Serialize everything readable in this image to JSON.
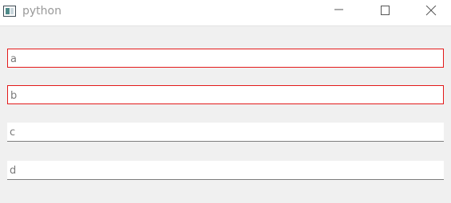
{
  "window": {
    "title": "python",
    "icon": "python-app-window-icon",
    "controls": {
      "minimize_icon": "minimize-icon",
      "maximize_icon": "maximize-icon",
      "close_icon": "close-icon"
    }
  },
  "fields": [
    {
      "value": "a",
      "state": "error",
      "border_color": "#e31a1a"
    },
    {
      "value": "b",
      "state": "error",
      "border_color": "#e31a1a"
    },
    {
      "value": "c",
      "state": "normal",
      "border_color": "#7d7d7d"
    },
    {
      "value": "d",
      "state": "normal",
      "border_color": "#7d7d7d"
    }
  ],
  "colors": {
    "background": "#f0f0f0",
    "titlebar": "#ffffff",
    "title_text": "#999999",
    "error_border": "#e31a1a"
  }
}
